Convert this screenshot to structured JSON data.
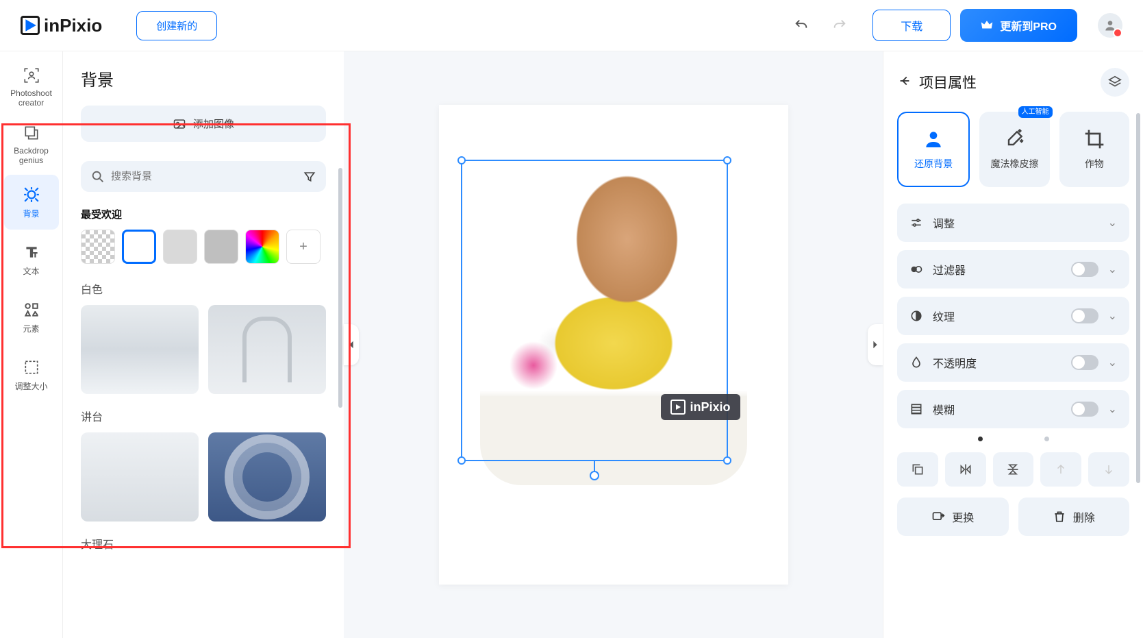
{
  "app": {
    "name": "inPixio"
  },
  "topbar": {
    "create": "创建新的",
    "download": "下载",
    "pro": "更新到PRO"
  },
  "tools": {
    "photoshoot": "Photoshoot creator",
    "backdrop": "Backdrop genius",
    "background": "背景",
    "text": "文本",
    "elements": "元素",
    "resize": "调整大小"
  },
  "panel": {
    "title": "背景",
    "add_image": "添加图像",
    "search_placeholder": "搜索背景",
    "popular": "最受欢迎",
    "cat_white": "白色",
    "cat_podium": "讲台",
    "cat_marble": "大理石"
  },
  "canvas": {
    "watermark_text": "inPixio"
  },
  "props": {
    "title": "项目属性",
    "restore_bg": "还原背景",
    "magic_eraser": "魔法橡皮擦",
    "ai_badge": "人工智能",
    "crop": "作物",
    "adjust": "调整",
    "filter": "过滤器",
    "texture": "纹理",
    "opacity": "不透明度",
    "blur": "模糊",
    "replace": "更换",
    "delete": "删除"
  }
}
